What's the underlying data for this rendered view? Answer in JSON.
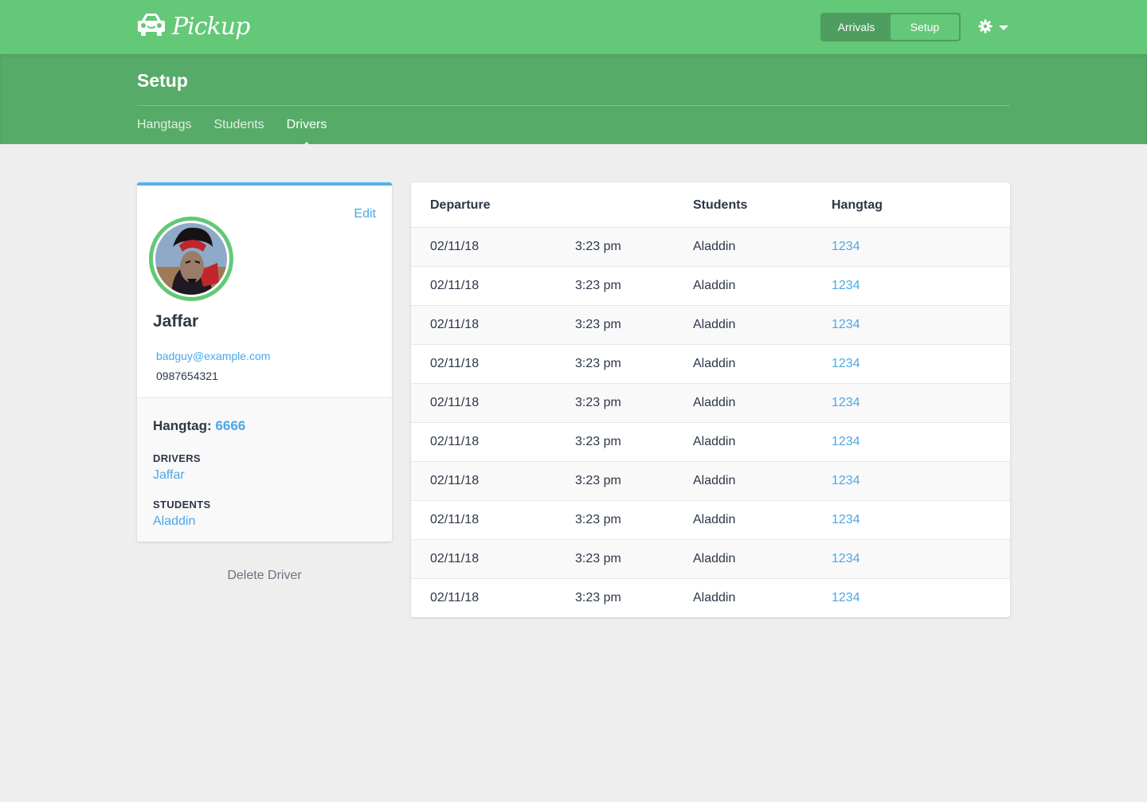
{
  "app": {
    "brand": "Pickup",
    "nav_toggle": [
      {
        "label": "Arrivals",
        "active": false
      },
      {
        "label": "Setup",
        "active": true
      }
    ],
    "settings_icon": "gear-icon",
    "colors": {
      "primary": "#63c878",
      "primary_dark": "#56ab68",
      "link": "#4aa8e8",
      "card_accent": "#57b2ea"
    }
  },
  "page": {
    "title": "Setup",
    "tabs": [
      {
        "label": "Hangtags",
        "active": false
      },
      {
        "label": "Students",
        "active": false
      },
      {
        "label": "Drivers",
        "active": true
      }
    ]
  },
  "driver": {
    "edit_label": "Edit",
    "name": "Jaffar",
    "email": "badguy@example.com",
    "phone": "0987654321",
    "hangtag_label": "Hangtag:",
    "hangtag_number": "6666",
    "drivers_label": "DRIVERS",
    "drivers_value": "Jaffar",
    "students_label": "STUDENTS",
    "students_value": "Aladdin",
    "delete_label": "Delete Driver"
  },
  "table": {
    "headers": {
      "departure": "Departure",
      "students": "Students",
      "hangtag": "Hangtag"
    },
    "rows": [
      {
        "date": "02/11/18",
        "time": "3:23 pm",
        "student": "Aladdin",
        "hangtag": "1234"
      },
      {
        "date": "02/11/18",
        "time": "3:23 pm",
        "student": "Aladdin",
        "hangtag": "1234"
      },
      {
        "date": "02/11/18",
        "time": "3:23 pm",
        "student": "Aladdin",
        "hangtag": "1234"
      },
      {
        "date": "02/11/18",
        "time": "3:23 pm",
        "student": "Aladdin",
        "hangtag": "1234"
      },
      {
        "date": "02/11/18",
        "time": "3:23 pm",
        "student": "Aladdin",
        "hangtag": "1234"
      },
      {
        "date": "02/11/18",
        "time": "3:23 pm",
        "student": "Aladdin",
        "hangtag": "1234"
      },
      {
        "date": "02/11/18",
        "time": "3:23 pm",
        "student": "Aladdin",
        "hangtag": "1234"
      },
      {
        "date": "02/11/18",
        "time": "3:23 pm",
        "student": "Aladdin",
        "hangtag": "1234"
      },
      {
        "date": "02/11/18",
        "time": "3:23 pm",
        "student": "Aladdin",
        "hangtag": "1234"
      },
      {
        "date": "02/11/18",
        "time": "3:23 pm",
        "student": "Aladdin",
        "hangtag": "1234"
      }
    ]
  }
}
